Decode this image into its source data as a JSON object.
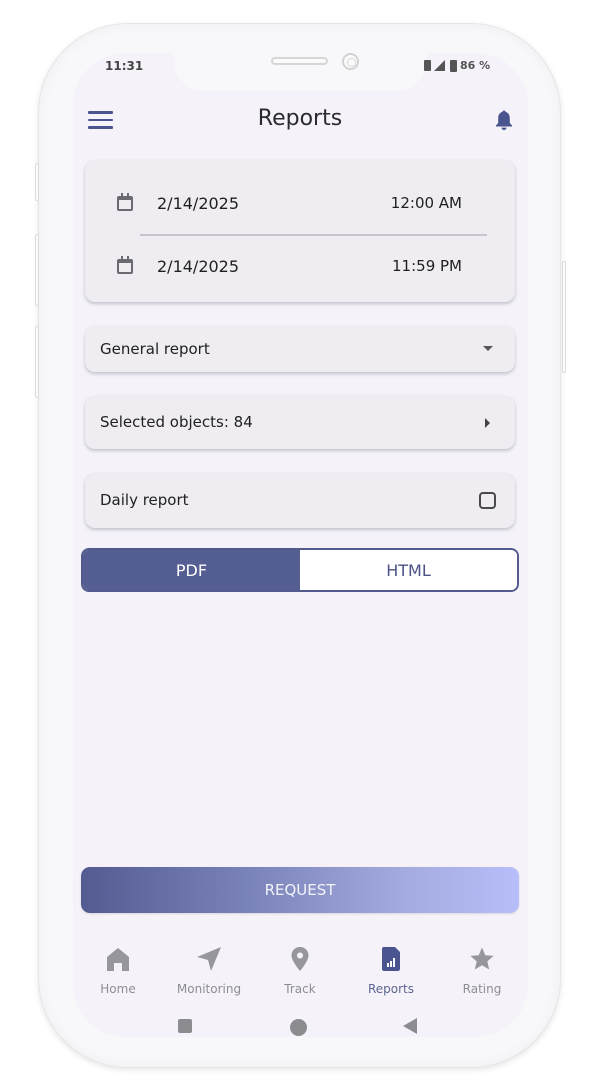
{
  "status_bar": {
    "time": "11:31",
    "battery": "86 %"
  },
  "header": {
    "title": "Reports",
    "menu_icon": "hamburger-menu-icon",
    "notification_icon": "bell-icon"
  },
  "date_range": {
    "start": {
      "date": "2/14/2025",
      "time": "12:00 AM",
      "icon": "calendar-icon"
    },
    "end": {
      "date": "2/14/2025",
      "time": "11:59 PM",
      "icon": "calendar-icon"
    }
  },
  "report_type": {
    "selected": "General report",
    "icon": "dropdown-arrow-icon"
  },
  "objects": {
    "label": "Selected objects: 84",
    "icon": "chevron-right-icon"
  },
  "daily_report": {
    "label": "Daily report",
    "checked": false
  },
  "format_toggle": {
    "options": [
      "PDF",
      "HTML"
    ],
    "selected": "PDF"
  },
  "request_button": {
    "label": "REQUEST"
  },
  "bottom_nav": {
    "items": [
      {
        "label": "Home",
        "icon": "home-icon",
        "active": false
      },
      {
        "label": "Monitoring",
        "icon": "navigation-arrow-icon",
        "active": false
      },
      {
        "label": "Track",
        "icon": "map-pin-icon",
        "active": false
      },
      {
        "label": "Reports",
        "icon": "report-chart-icon",
        "active": true
      },
      {
        "label": "Rating",
        "icon": "star-icon",
        "active": false
      }
    ]
  },
  "colors": {
    "accent": "#555e92",
    "background": "#f5f3f9",
    "card": "#efedf2",
    "inactive_icon": "#97969c"
  }
}
